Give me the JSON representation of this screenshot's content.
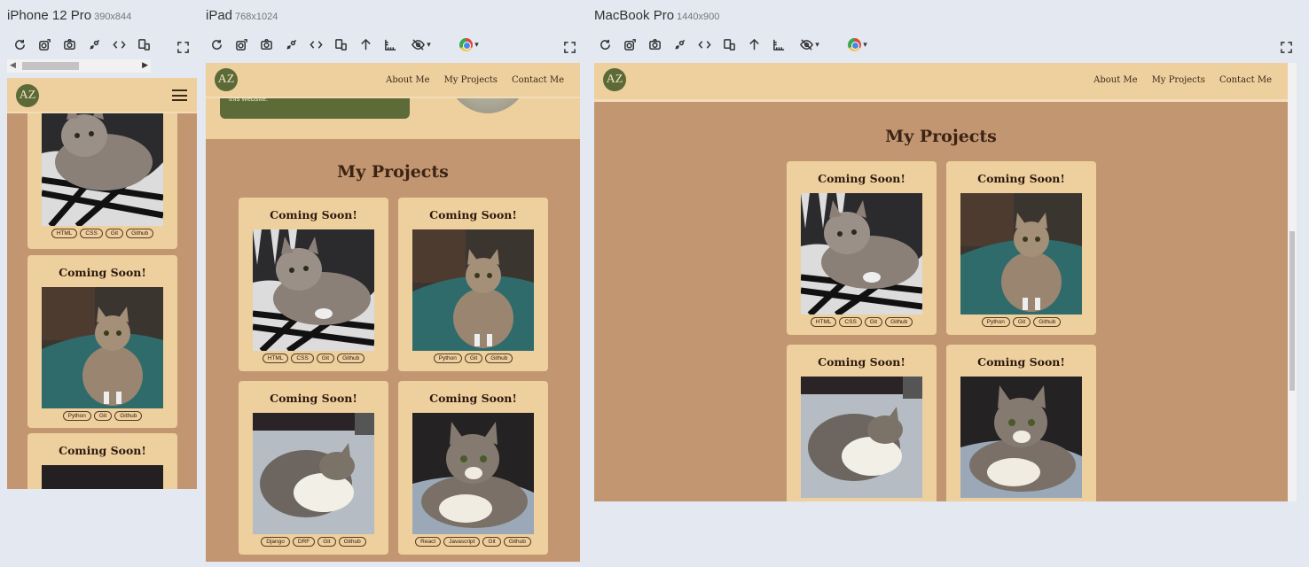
{
  "devices": {
    "iphone": {
      "name": "iPhone 12 Pro",
      "size": "390x844"
    },
    "ipad": {
      "name": "iPad",
      "size": "768x1024"
    },
    "macbook": {
      "name": "MacBook Pro",
      "size": "1440x900"
    }
  },
  "toolbar_icons": [
    "rotate-icon",
    "device-frame-icon",
    "screenshot-icon",
    "touch-icon",
    "code-icon",
    "responsive-icon",
    "arrow-up-icon",
    "ruler-icon",
    "eye-off-icon",
    "chrome-icon",
    "expand-icon"
  ],
  "site": {
    "logo": "AZ",
    "nav": [
      "About Me",
      "My Projects",
      "Contact Me"
    ],
    "hero_snippet": "this website.",
    "section_title": "My Projects",
    "projects": [
      {
        "title": "Coming Soon!",
        "tags": [
          "HTML",
          "CSS",
          "Git",
          "Github"
        ],
        "photo": "cat-lying-blanket"
      },
      {
        "title": "Coming Soon!",
        "tags": [
          "Python",
          "Git",
          "Github"
        ],
        "photo": "cat-sitting-chair"
      },
      {
        "title": "Coming Soon!",
        "tags": [
          "Django",
          "DRF",
          "Git",
          "Github"
        ],
        "photo": "cat-sleeping-bed"
      },
      {
        "title": "Coming Soon!",
        "tags": [
          "React",
          "Javascript",
          "Git",
          "Github"
        ],
        "photo": "cat-lounging-bed"
      }
    ]
  },
  "colors": {
    "page_bg": "#c29670",
    "nav_bg": "#eecf9e",
    "logo_bg": "#5b6a36",
    "hero_box": "#5d6b38",
    "title_text": "#3b2415"
  }
}
